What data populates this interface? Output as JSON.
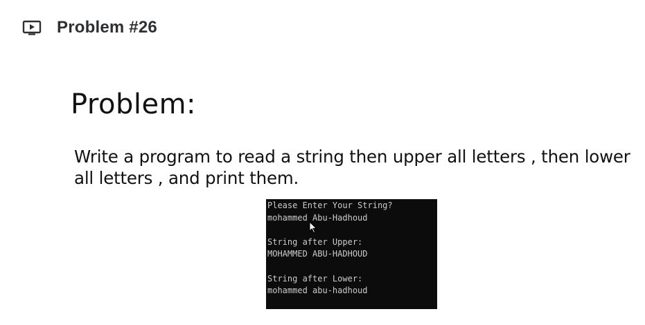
{
  "header": {
    "icon": "video-play-icon",
    "title": "Problem #26"
  },
  "slide": {
    "heading": "Problem:",
    "description": "Write a program to read a string then upper all letters , then lower all letters , and print them."
  },
  "console": {
    "lines": [
      "Please Enter Your String?",
      "mohammed Abu-Hadhoud",
      "",
      "String after Upper:",
      "MOHAMMED ABU-HADHOUD",
      "",
      "String after Lower:",
      "mohammed abu-hadhoud"
    ]
  },
  "colors": {
    "header_text": "#2d2f31",
    "console_bg": "#0c0c0c",
    "console_text": "#cccccc"
  }
}
